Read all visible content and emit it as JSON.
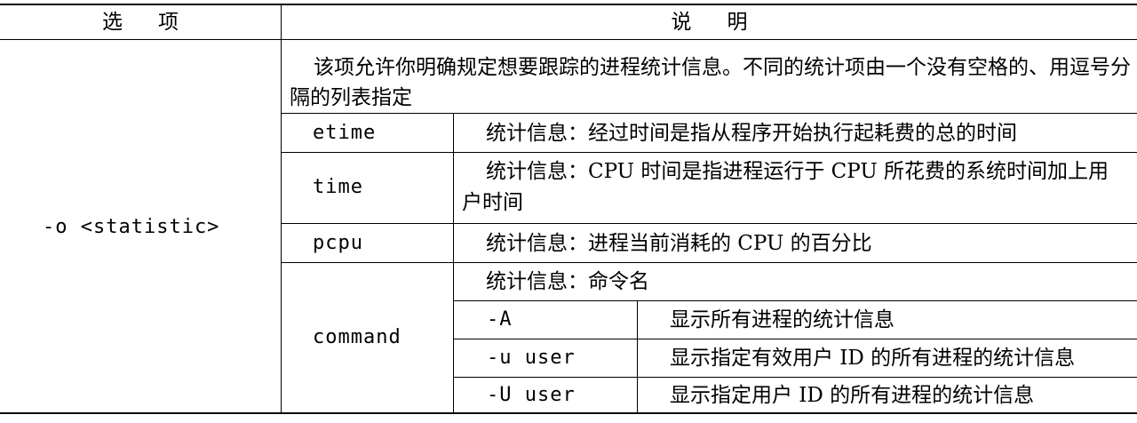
{
  "header": {
    "option_col": [
      "选",
      "项"
    ],
    "desc_col": [
      "说",
      "明"
    ]
  },
  "option": {
    "name": "-o <statistic>",
    "intro": "该项允许你明确规定想要跟踪的进程统计信息。不同的统计项由一个没有空格的、用逗号分隔的列表指定",
    "stats": [
      {
        "name": "etime",
        "desc": "统计信息：经过时间是指从程序开始执行起耗费的总的时间"
      },
      {
        "name": "time",
        "desc": "统计信息：CPU 时间是指进程运行于 CPU 所花费的系统时间加上用户时间"
      },
      {
        "name": "pcpu",
        "desc": "统计信息：进程当前消耗的 CPU 的百分比"
      },
      {
        "name": "command",
        "desc": "统计信息：命令名",
        "sub": [
          {
            "flag": "-A",
            "desc": "显示所有进程的统计信息"
          },
          {
            "flag": "-u user",
            "desc": "显示指定有效用户 ID 的所有进程的统计信息"
          },
          {
            "flag": "-U user",
            "desc": "显示指定用户 ID 的所有进程的统计信息"
          }
        ]
      }
    ]
  }
}
